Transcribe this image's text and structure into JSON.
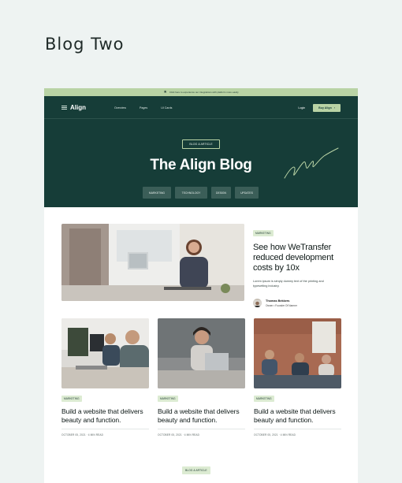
{
  "page": {
    "heading": "Blog Two"
  },
  "announcement": {
    "text": "Click here to experience our integrations with platform more easily"
  },
  "nav": {
    "logo_text": "Align",
    "links": [
      "Overview",
      "Pages",
      "UI Cards"
    ],
    "login_label": "Login",
    "buy_label": "Buy Align"
  },
  "hero": {
    "badge": "BLOG & ARTICLE",
    "title": "The Align Blog",
    "tags": [
      "MARKETING",
      "TECHNOLOGY",
      "DESIGN",
      "UPDATES"
    ]
  },
  "featured": {
    "tag": "MARKETING",
    "title": "See how WeTransfer reduced development costs by 10x",
    "description": "Lorem ipsum is simply dummy text of the printing and typesetting industry.",
    "author_name": "Thomas Bekkers",
    "author_role": "Owner • Founder Of Narmer"
  },
  "cards": [
    {
      "tag": "MARKETING",
      "title": "Build a website that delivers beauty and function.",
      "meta": "OCTOBER 05, 2021 · 4 MIN READ"
    },
    {
      "tag": "MARKETING",
      "title": "Build a website that delivers beauty and function.",
      "meta": "OCTOBER 05, 2021 · 4 MIN READ"
    },
    {
      "tag": "MARKETING",
      "title": "Build a website that delivers beauty and function.",
      "meta": "OCTOBER 05, 2021 · 4 MIN READ"
    }
  ],
  "bottom": {
    "badge": "BLOG & ARTICLE"
  },
  "colors": {
    "hero_bg": "#163d38",
    "accent": "#b9d3a5",
    "page_bg": "#eef3f2"
  }
}
